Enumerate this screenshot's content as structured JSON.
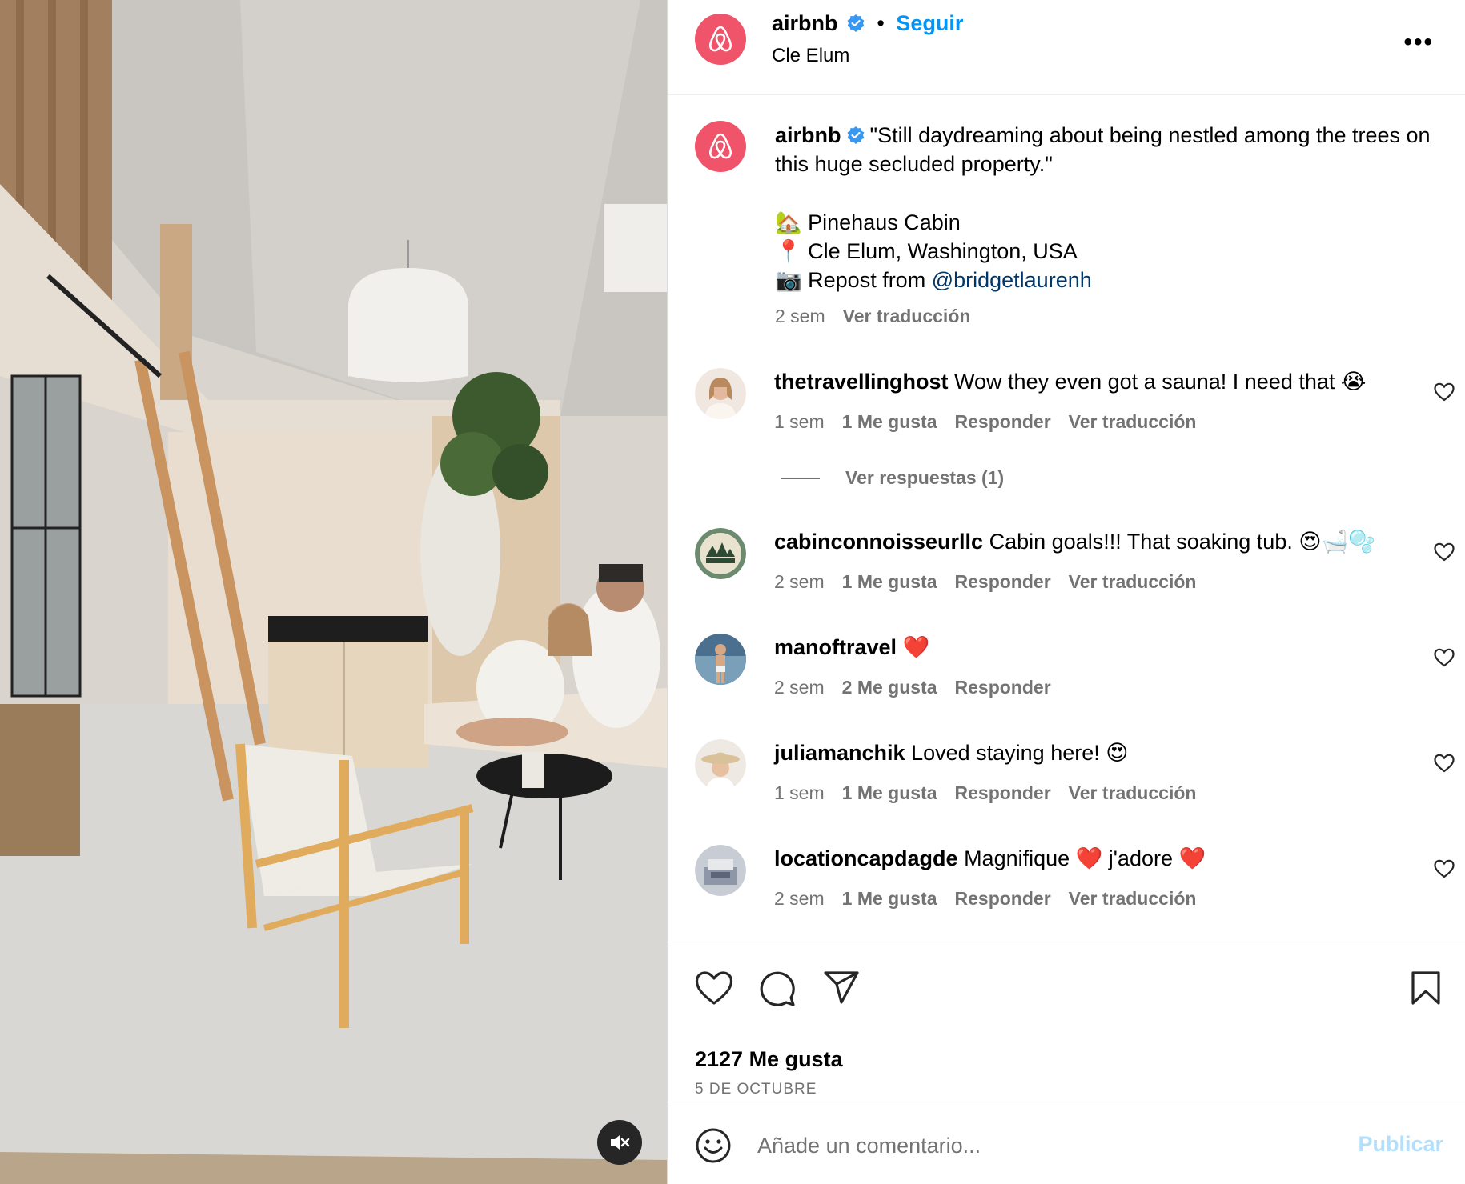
{
  "post": {
    "author": "airbnb",
    "separator": "•",
    "follow_label": "Seguir",
    "location": "Cle Elum",
    "more_label": "•••"
  },
  "caption": {
    "author": "airbnb",
    "quote": "\"Still daydreaming about being nestled among the trees on this huge secluded property.\"",
    "line1_emoji": "🏡",
    "line1": "Pinehaus Cabin",
    "line2_emoji": "📍",
    "line2": "Cle Elum, Washington, USA",
    "line3_emoji": "📷",
    "line3_prefix": "Repost from ",
    "line3_mention": "@bridgetlaurenh",
    "time": "2 sem",
    "translate": "Ver traducción"
  },
  "comments": [
    {
      "user": "thetravellinghost",
      "text": "Wow they even got a sauna! I need that 😭",
      "time": "1 sem",
      "likes": "1 Me gusta",
      "reply": "Responder",
      "translate": "Ver traducción"
    },
    {
      "user": "cabinconnoisseurllc",
      "text": "Cabin goals!!! That soaking tub. 😍🛁🫧",
      "time": "2 sem",
      "likes": "1 Me gusta",
      "reply": "Responder",
      "translate": "Ver traducción"
    },
    {
      "user": "manoftravel",
      "text": "❤️",
      "time": "2 sem",
      "likes": "2 Me gusta",
      "reply": "Responder",
      "translate": ""
    },
    {
      "user": "juliamanchik",
      "text": "Loved staying here! 😍",
      "time": "1 sem",
      "likes": "1 Me gusta",
      "reply": "Responder",
      "translate": "Ver traducción"
    },
    {
      "user": "locationcapdagde",
      "text": "Magnifique ❤️ j'adore ❤️",
      "time": "2 sem",
      "likes": "1 Me gusta",
      "reply": "Responder",
      "translate": "Ver traducción"
    }
  ],
  "view_replies": "Ver respuestas (1)",
  "likes_count": "2127 Me gusta",
  "date": "5 DE OCTUBRE",
  "composer": {
    "placeholder": "Añade un comentario...",
    "publish_label": "Publicar"
  },
  "colors": {
    "brand": "#f0546a",
    "link": "#0095f6",
    "verified": "#3897f0",
    "muted": "#737373"
  },
  "icons": [
    "airbnb-logo-icon",
    "verified-icon",
    "more-icon",
    "heart-icon",
    "comment-icon",
    "share-icon",
    "bookmark-icon",
    "emoji-icon",
    "mute-icon"
  ]
}
